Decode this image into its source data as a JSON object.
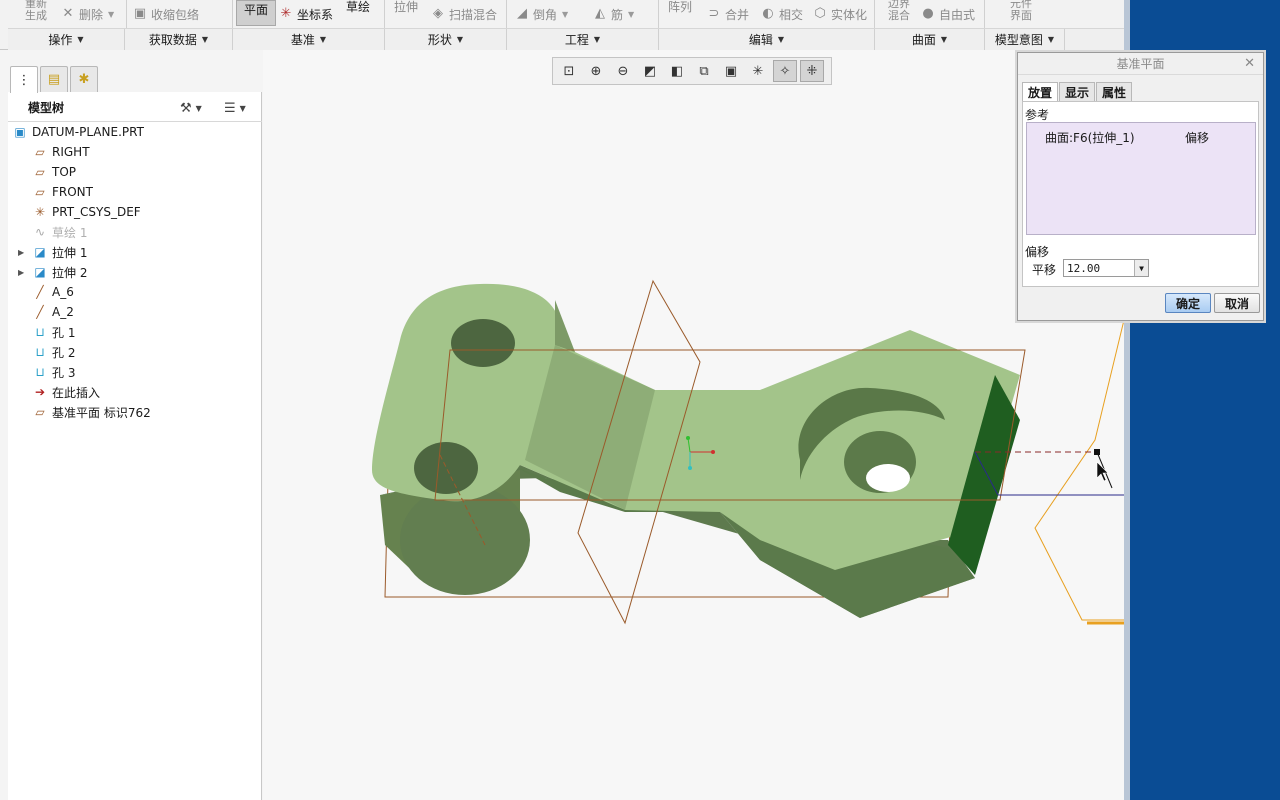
{
  "ribbon": {
    "top_items": {
      "regenerate": "重新生成",
      "delete": "删除",
      "shrinkwrap": "收缩包络",
      "plane": "平面",
      "csys": "坐标系",
      "sketch": "草绘",
      "extrude": "拉伸",
      "swept_blend": "扫描混合",
      "chamfer": "倒角",
      "rib": "筋",
      "pattern": "阵列",
      "merge": "合并",
      "intersect": "相交",
      "solidify": "实体化",
      "boundary_blend": "边界混合",
      "freestyle": "自由式",
      "component_interface": "元件界面"
    },
    "groups": [
      "操作",
      "获取数据",
      "基准",
      "形状",
      "工程",
      "编辑",
      "曲面",
      "模型意图"
    ]
  },
  "model_tree": {
    "title": "模型树",
    "items": [
      {
        "label": "DATUM-PLANE.PRT",
        "icon": "part-icon",
        "expandable": false,
        "dim": false
      },
      {
        "label": "RIGHT",
        "icon": "datum-plane-icon",
        "expandable": false,
        "dim": false
      },
      {
        "label": "TOP",
        "icon": "datum-plane-icon",
        "expandable": false,
        "dim": false
      },
      {
        "label": "FRONT",
        "icon": "datum-plane-icon",
        "expandable": false,
        "dim": false
      },
      {
        "label": "PRT_CSYS_DEF",
        "icon": "csys-icon",
        "expandable": false,
        "dim": false
      },
      {
        "label": "草绘 1",
        "icon": "sketch-icon",
        "expandable": false,
        "dim": true
      },
      {
        "label": "拉伸 1",
        "icon": "extrude-icon",
        "expandable": true,
        "dim": false
      },
      {
        "label": "拉伸 2",
        "icon": "extrude-icon",
        "expandable": true,
        "dim": false
      },
      {
        "label": "A_6",
        "icon": "axis-icon",
        "expandable": false,
        "dim": false
      },
      {
        "label": "A_2",
        "icon": "axis-icon",
        "expandable": false,
        "dim": false
      },
      {
        "label": "孔 1",
        "icon": "hole-icon",
        "expandable": false,
        "dim": false
      },
      {
        "label": "孔 2",
        "icon": "hole-icon",
        "expandable": false,
        "dim": false
      },
      {
        "label": "孔 3",
        "icon": "hole-icon",
        "expandable": false,
        "dim": false
      },
      {
        "label": "在此插入",
        "icon": "insert-here-arrow-icon",
        "expandable": false,
        "dim": false
      },
      {
        "label": "基准平面 标识762",
        "icon": "datum-plane-new-icon",
        "expandable": false,
        "dim": false
      }
    ]
  },
  "dialog": {
    "title": "基准平面",
    "tabs": [
      "放置",
      "显示",
      "属性"
    ],
    "references_label": "参考",
    "reference": {
      "surface": "曲面:F6(拉伸_1)",
      "type": "偏移"
    },
    "offset_label": "偏移",
    "translation_label": "平移",
    "translation_value": "12.00",
    "ok": "确定",
    "cancel": "取消"
  },
  "colors": {
    "desktop": "#0a4c94",
    "model_face": "#a3c48a",
    "model_side": "#6a8a58",
    "selected_face": "#1f5e20",
    "datum_plane": "#9a5a2a",
    "new_datum_plane": "#e8a020",
    "accent_button": "#a9ccf2"
  }
}
